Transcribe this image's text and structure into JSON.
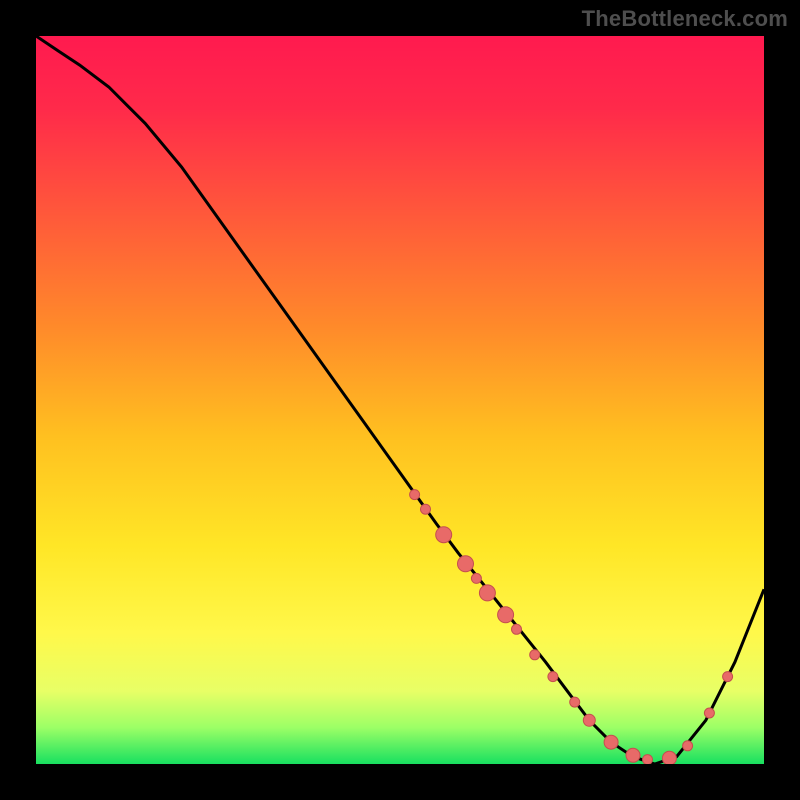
{
  "watermark": "TheBottleneck.com",
  "palette": {
    "background": "#000000",
    "gradient_stops": [
      {
        "offset": 0.0,
        "color": "#ff1a4f"
      },
      {
        "offset": 0.1,
        "color": "#ff2a4a"
      },
      {
        "offset": 0.25,
        "color": "#ff5a3a"
      },
      {
        "offset": 0.4,
        "color": "#ff8a2a"
      },
      {
        "offset": 0.55,
        "color": "#ffc020"
      },
      {
        "offset": 0.7,
        "color": "#ffe626"
      },
      {
        "offset": 0.82,
        "color": "#fff84a"
      },
      {
        "offset": 0.9,
        "color": "#e8ff66"
      },
      {
        "offset": 0.95,
        "color": "#9cff66"
      },
      {
        "offset": 1.0,
        "color": "#18e060"
      }
    ],
    "curve_color": "#000000",
    "marker_fill": "#e86a68",
    "marker_stroke": "#c44f4e"
  },
  "chart_data": {
    "type": "line",
    "title": "",
    "xlabel": "",
    "ylabel": "",
    "xlim": [
      0,
      100
    ],
    "ylim": [
      0,
      100
    ],
    "grid": false,
    "legend": false,
    "series": [
      {
        "name": "curve",
        "x": [
          0,
          3,
          6,
          10,
          15,
          20,
          25,
          30,
          35,
          40,
          45,
          50,
          55,
          58,
          62,
          66,
          70,
          73,
          76,
          79,
          82,
          85,
          88,
          92,
          96,
          100
        ],
        "y": [
          100,
          98,
          96,
          93,
          88,
          82,
          75,
          68,
          61,
          54,
          47,
          40,
          33,
          29,
          24,
          19,
          14,
          10,
          6,
          3,
          1,
          0,
          1,
          6,
          14,
          24
        ]
      }
    ],
    "markers": [
      {
        "x": 52,
        "y": 37,
        "r": 5
      },
      {
        "x": 53.5,
        "y": 35,
        "r": 5
      },
      {
        "x": 56,
        "y": 31.5,
        "r": 8
      },
      {
        "x": 59,
        "y": 27.5,
        "r": 8
      },
      {
        "x": 60.5,
        "y": 25.5,
        "r": 5
      },
      {
        "x": 62,
        "y": 23.5,
        "r": 8
      },
      {
        "x": 64.5,
        "y": 20.5,
        "r": 8
      },
      {
        "x": 66,
        "y": 18.5,
        "r": 5
      },
      {
        "x": 68.5,
        "y": 15,
        "r": 5
      },
      {
        "x": 71,
        "y": 12,
        "r": 5
      },
      {
        "x": 74,
        "y": 8.5,
        "r": 5
      },
      {
        "x": 76,
        "y": 6,
        "r": 6
      },
      {
        "x": 79,
        "y": 3,
        "r": 7
      },
      {
        "x": 82,
        "y": 1.2,
        "r": 7
      },
      {
        "x": 84,
        "y": 0.6,
        "r": 5
      },
      {
        "x": 87,
        "y": 0.8,
        "r": 7
      },
      {
        "x": 89.5,
        "y": 2.5,
        "r": 5
      },
      {
        "x": 92.5,
        "y": 7,
        "r": 5
      },
      {
        "x": 95,
        "y": 12,
        "r": 5
      }
    ]
  }
}
